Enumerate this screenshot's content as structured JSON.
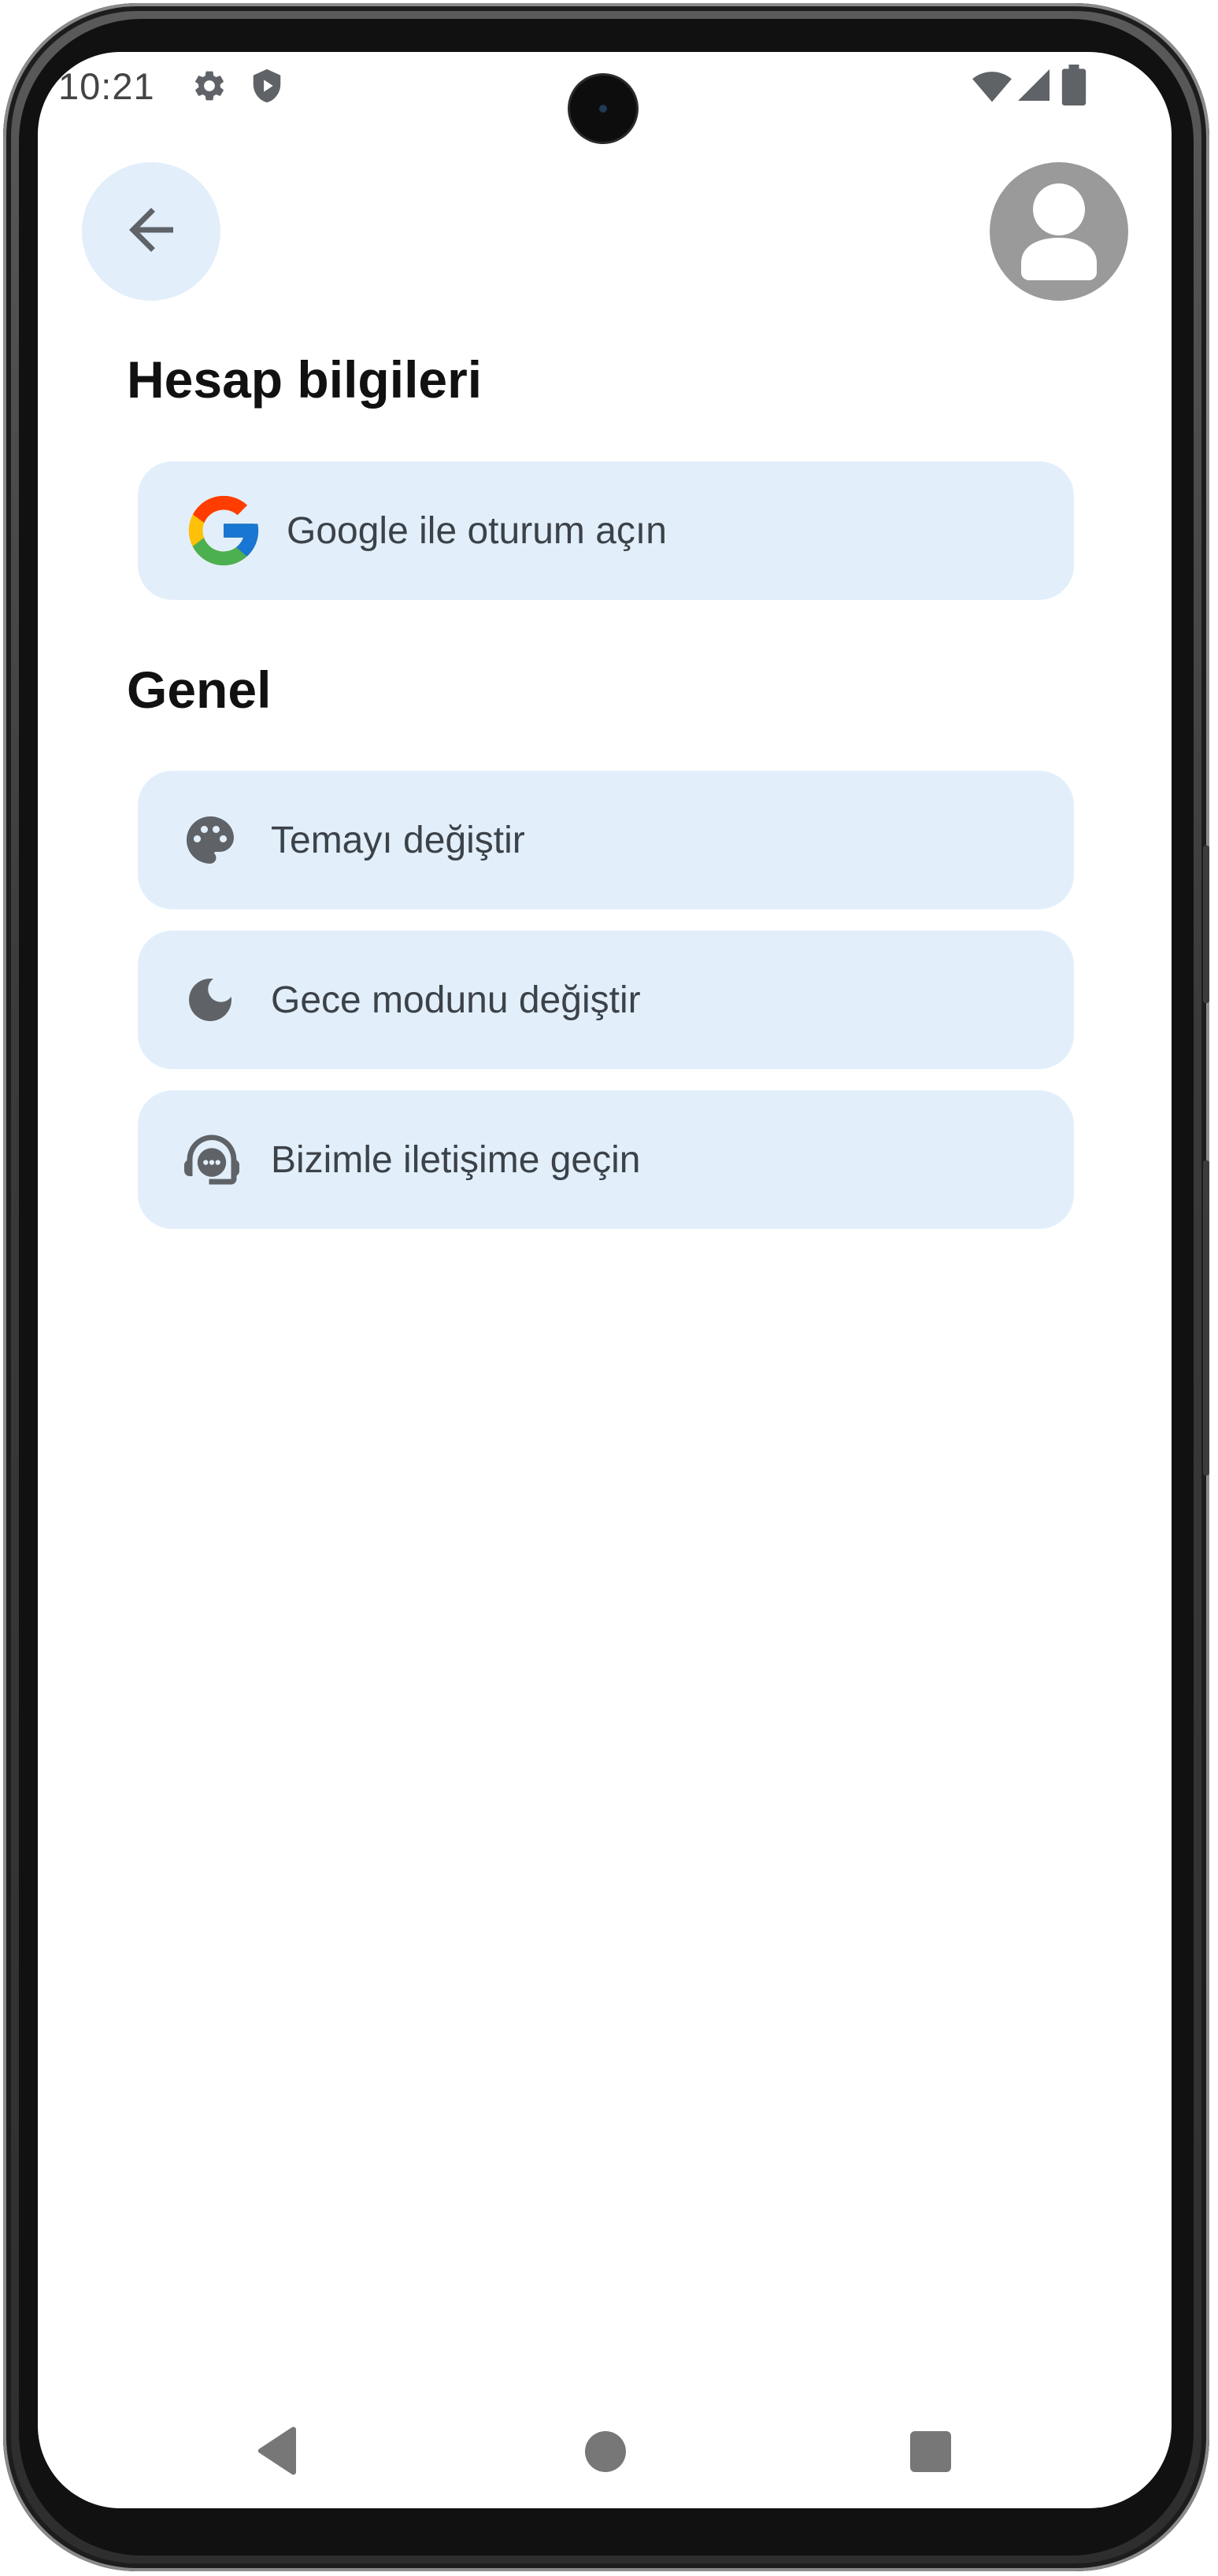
{
  "status_bar": {
    "time": "10:21",
    "icons": [
      "gear-icon",
      "shield-play-icon",
      "wifi-icon",
      "cellular-signal-icon",
      "battery-icon"
    ]
  },
  "header": {
    "back_icon": "arrow-left-icon",
    "avatar_icon": "person-icon"
  },
  "account_section": {
    "title": "Hesap bilgileri",
    "items": [
      {
        "label": "Google ile oturum açın",
        "icon": "google-logo-icon"
      }
    ]
  },
  "general_section": {
    "title": "Genel",
    "items": [
      {
        "label": "Temayı değiştir",
        "icon": "palette-icon"
      },
      {
        "label": "Gece modunu değiştir",
        "icon": "moon-icon"
      },
      {
        "label": "Bizimle iletişime geçin",
        "icon": "support-agent-icon"
      }
    ]
  },
  "nav_bar": {
    "buttons": [
      "nav-back-icon",
      "nav-home-icon",
      "nav-recents-icon"
    ]
  },
  "colors": {
    "card_background": "#e2effb",
    "back_button_background": "#e2eefa",
    "avatar_background": "#9a9a9a",
    "icon_color": "#5f6368",
    "label_color": "#3c4248",
    "heading_color": "#111111"
  }
}
